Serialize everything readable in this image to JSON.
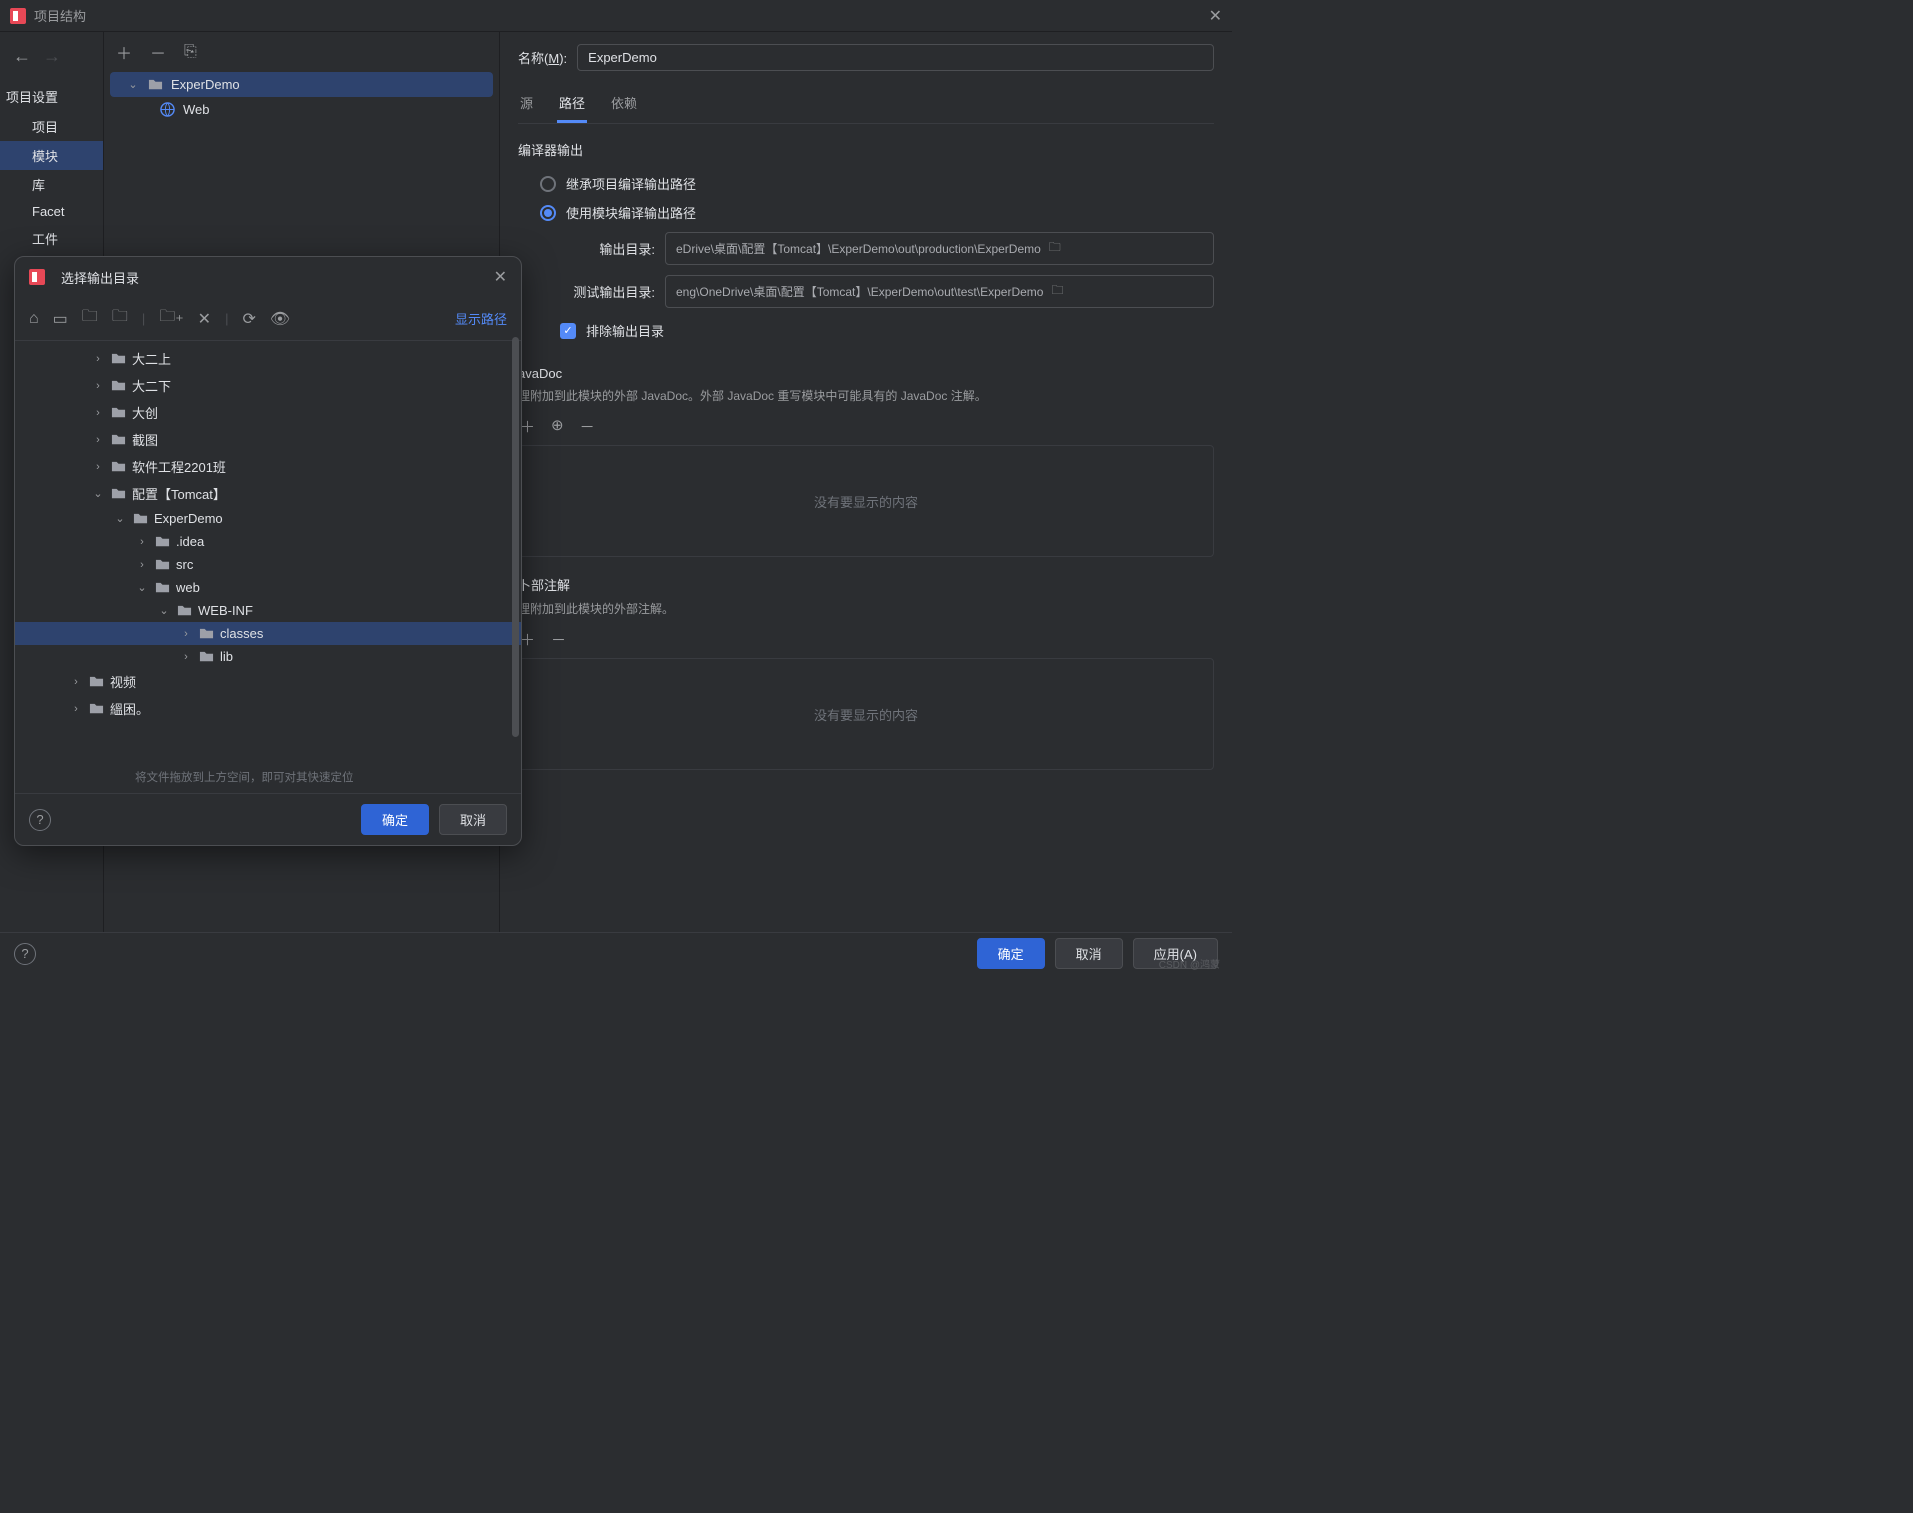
{
  "titlebar": {
    "title": "项目结构"
  },
  "sidebar": {
    "section_label": "项目设置",
    "items": [
      {
        "label": "项目"
      },
      {
        "label": "模块"
      },
      {
        "label": "库"
      },
      {
        "label": "Facet"
      },
      {
        "label": "工件"
      }
    ]
  },
  "module_tree": {
    "root": "ExperDemo",
    "child": "Web"
  },
  "content": {
    "name_key": "名称",
    "name_mnemonic": "M",
    "name_value": "ExperDemo",
    "tabs": [
      {
        "label": "源"
      },
      {
        "label": "路径"
      },
      {
        "label": "依赖"
      }
    ],
    "compiler_section": "编译器输出",
    "radio_inherit": "继承项目编译输出路径",
    "radio_module": "使用模块编译输出路径",
    "output_label": "输出目录:",
    "output_value": "eDrive\\桌面\\配置【Tomcat】\\ExperDemo\\out\\production\\ExperDemo",
    "test_output_label": "测试输出目录:",
    "test_output_value": "eng\\OneDrive\\桌面\\配置【Tomcat】\\ExperDemo\\out\\test\\ExperDemo",
    "exclude_label": "排除输出目录",
    "javadoc_title": "avaDoc",
    "javadoc_desc": "理附加到此模块的外部 JavaDoc。外部 JavaDoc 重写模块中可能具有的 JavaDoc 注解。",
    "ext_annot_title": "卜部注解",
    "ext_annot_desc": "理附加到此模块的外部注解。",
    "empty_text": "没有要显示的内容"
  },
  "dialog": {
    "title": "选择输出目录",
    "show_path": "显示路径",
    "tree": [
      {
        "indent": 3,
        "chev": "›",
        "label": "大二上"
      },
      {
        "indent": 3,
        "chev": "›",
        "label": "大二下"
      },
      {
        "indent": 3,
        "chev": "›",
        "label": "大创"
      },
      {
        "indent": 3,
        "chev": "›",
        "label": "截图"
      },
      {
        "indent": 3,
        "chev": "›",
        "label": "软件工程2201班"
      },
      {
        "indent": 3,
        "chev": "⌄",
        "label": "配置【Tomcat】"
      },
      {
        "indent": 4,
        "chev": "⌄",
        "label": "ExperDemo"
      },
      {
        "indent": 5,
        "chev": "›",
        "label": ".idea"
      },
      {
        "indent": 5,
        "chev": "›",
        "label": "src"
      },
      {
        "indent": 5,
        "chev": "⌄",
        "label": "web"
      },
      {
        "indent": 6,
        "chev": "⌄",
        "label": "WEB-INF"
      },
      {
        "indent": 7,
        "chev": "›",
        "label": "classes",
        "selected": true
      },
      {
        "indent": 7,
        "chev": "›",
        "label": "lib"
      },
      {
        "indent": 2,
        "chev": "›",
        "label": "视频"
      },
      {
        "indent": 2,
        "chev": "›",
        "label": "縕困。"
      }
    ],
    "hint": "将文件拖放到上方空间，即可对其快速定位",
    "ok": "确定",
    "cancel": "取消"
  },
  "buttons": {
    "ok": "确定",
    "cancel": "取消",
    "apply": "应用(A)"
  },
  "watermark": "CSDN @鸿蒙"
}
